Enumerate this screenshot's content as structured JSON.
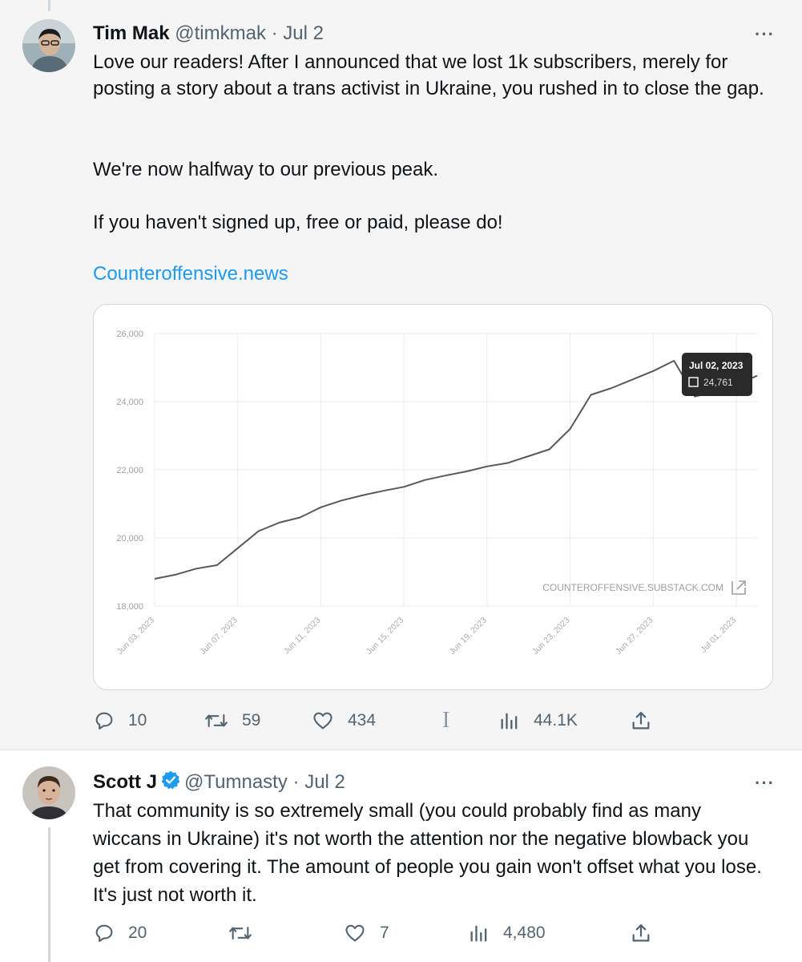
{
  "tweet1": {
    "name": "Tim Mak",
    "handle": "@timkmak",
    "date": "· Jul 2",
    "more": "···",
    "text": [
      "Love our readers! After I announced that we lost 1k subscribers, merely for posting a story about a trans activist in Ukraine, you rushed in to close the gap.",
      "We're now halfway to our previous peak.",
      "If you haven't signed up, free or paid, please do!"
    ],
    "link": "Counteroffensive.news",
    "actions": {
      "reply": "10",
      "retweet": "59",
      "like": "434",
      "views": "44.1K"
    }
  },
  "tweet2": {
    "name": "Scott J",
    "handle": "@Tumnasty",
    "date": "· Jul 2",
    "more": "···",
    "text": "That community is so extremely small (you could probably find as many wiccans in Ukraine) it's not worth the attention nor the negative blowback you get from covering it. The amount of people you gain won't offset what you lose. It's just not worth it.",
    "actions": {
      "reply": "20",
      "like": "7",
      "views": "4,480"
    }
  },
  "chart_data": {
    "type": "line",
    "title": "",
    "xlabel": "",
    "ylabel": "",
    "ylim": [
      18000,
      26000
    ],
    "y_ticks": [
      "26,000",
      "24,000",
      "22,000",
      "20,000",
      "18,000"
    ],
    "x_ticks": [
      "Jun 03, 2023",
      "Jun 07, 2023",
      "Jun 11, 2023",
      "Jun 15, 2023",
      "Jun 19, 2023",
      "Jun 23, 2023",
      "Jun 27, 2023",
      "Jul 01, 2023"
    ],
    "grid": true,
    "watermark": "COUNTEROFFENSIVE.SUBSTACK.COM",
    "tooltip": {
      "date": "Jul 02, 2023",
      "value": "24,761"
    },
    "series": [
      {
        "x": [
          "2023-06-03",
          "2023-06-04",
          "2023-06-05",
          "2023-06-06",
          "2023-06-07",
          "2023-06-08",
          "2023-06-09",
          "2023-06-10",
          "2023-06-11",
          "2023-06-12",
          "2023-06-13",
          "2023-06-14",
          "2023-06-15",
          "2023-06-16",
          "2023-06-17",
          "2023-06-18",
          "2023-06-19",
          "2023-06-20",
          "2023-06-21",
          "2023-06-22",
          "2023-06-23",
          "2023-06-24",
          "2023-06-25",
          "2023-06-26",
          "2023-06-27",
          "2023-06-28",
          "2023-06-29",
          "2023-06-30",
          "2023-07-01",
          "2023-07-02"
        ],
        "values": [
          18800,
          18920,
          19100,
          19200,
          19700,
          20200,
          20450,
          20600,
          20900,
          21100,
          21250,
          21380,
          21500,
          21700,
          21830,
          21950,
          22100,
          22200,
          22400,
          22600,
          23200,
          24200,
          24400,
          24650,
          24900,
          25200,
          24150,
          24300,
          24500,
          24761
        ]
      }
    ]
  }
}
